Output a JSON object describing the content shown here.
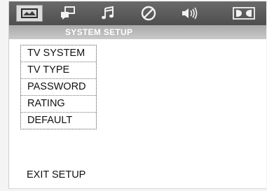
{
  "icon_bar": {
    "icons": [
      {
        "name": "system-setup-icon",
        "active": true
      },
      {
        "name": "language-setup-icon",
        "active": false
      },
      {
        "name": "audio-setup-icon",
        "active": false
      },
      {
        "name": "video-setup-icon",
        "active": false
      },
      {
        "name": "speaker-setup-icon",
        "active": false
      },
      {
        "name": "dolby-digital-icon",
        "active": false
      }
    ]
  },
  "title_bar": {
    "title": "SYSTEM SETUP"
  },
  "menu": {
    "items": [
      {
        "label": "TV SYSTEM"
      },
      {
        "label": "TV TYPE"
      },
      {
        "label": "PASSWORD"
      },
      {
        "label": "RATING"
      },
      {
        "label": "DEFAULT"
      }
    ]
  },
  "footer": {
    "exit_label": "EXIT SETUP"
  }
}
